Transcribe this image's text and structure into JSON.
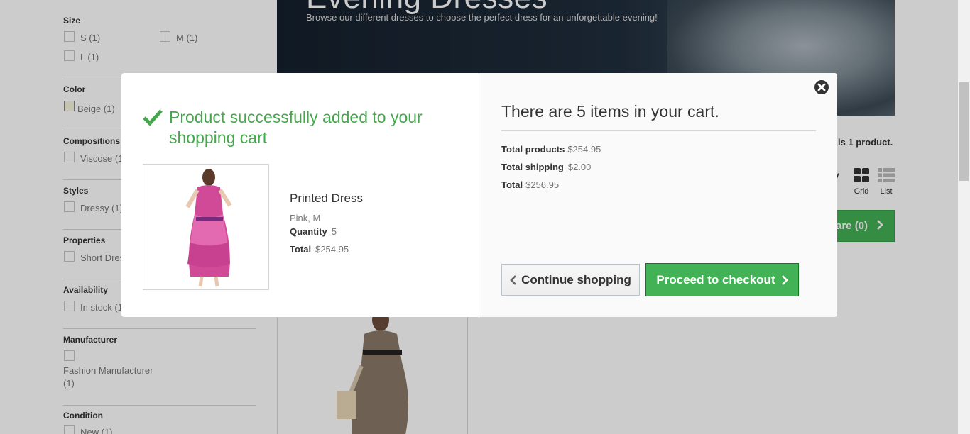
{
  "sidebar": {
    "size": {
      "title": "Size",
      "options": [
        "S (1)",
        "M (1)",
        "L (1)"
      ]
    },
    "color": {
      "title": "Color",
      "options": [
        "Beige (1)"
      ]
    },
    "compositions": {
      "title": "Compositions",
      "options": [
        "Viscose (1"
      ]
    },
    "styles": {
      "title": "Styles",
      "options": [
        "Dressy (1)"
      ]
    },
    "properties": {
      "title": "Properties",
      "options": [
        "Short Dres"
      ]
    },
    "availability": {
      "title": "Availability",
      "options": [
        "In stock (1"
      ]
    },
    "manufacturer": {
      "title": "Manufacturer",
      "options": [
        "Fashion Manufacturer",
        "(1)"
      ]
    },
    "condition": {
      "title": "Condition",
      "options": [
        "New (1)"
      ]
    }
  },
  "banner": {
    "heading": "Evening Dresses",
    "subtitle": "Browse our different dresses to choose the perfect dress for an unforgettable evening!"
  },
  "toolbar": {
    "count_text": "is 1 product.",
    "view_label_fragment": "v",
    "grid_label": "Grid",
    "list_label": "List",
    "compare_label": "are (0)"
  },
  "modal": {
    "success_title": "Product successfully added to your shopping cart",
    "product": {
      "name": "Printed Dress",
      "attributes": "Pink, M",
      "quantity_label": "Quantity",
      "quantity_value": "5",
      "total_label": "Total",
      "total_value": "$254.95"
    },
    "cart": {
      "heading": "There are 5 items in your cart.",
      "total_products_label": "Total products",
      "total_products_value": "$254.95",
      "total_shipping_label": "Total shipping",
      "total_shipping_value": "$2.00",
      "total_label": "Total",
      "total_value": "$256.95"
    },
    "continue_label": "Continue shopping",
    "checkout_label": "Proceed to checkout"
  },
  "icons": {
    "success": "check-icon",
    "close": "close-icon",
    "continue": "chevron-left-icon",
    "checkout": "chevron-right-icon"
  },
  "colors": {
    "success_green": "#46a74e",
    "checkout_green": "#43b155",
    "dark": "#333333"
  }
}
